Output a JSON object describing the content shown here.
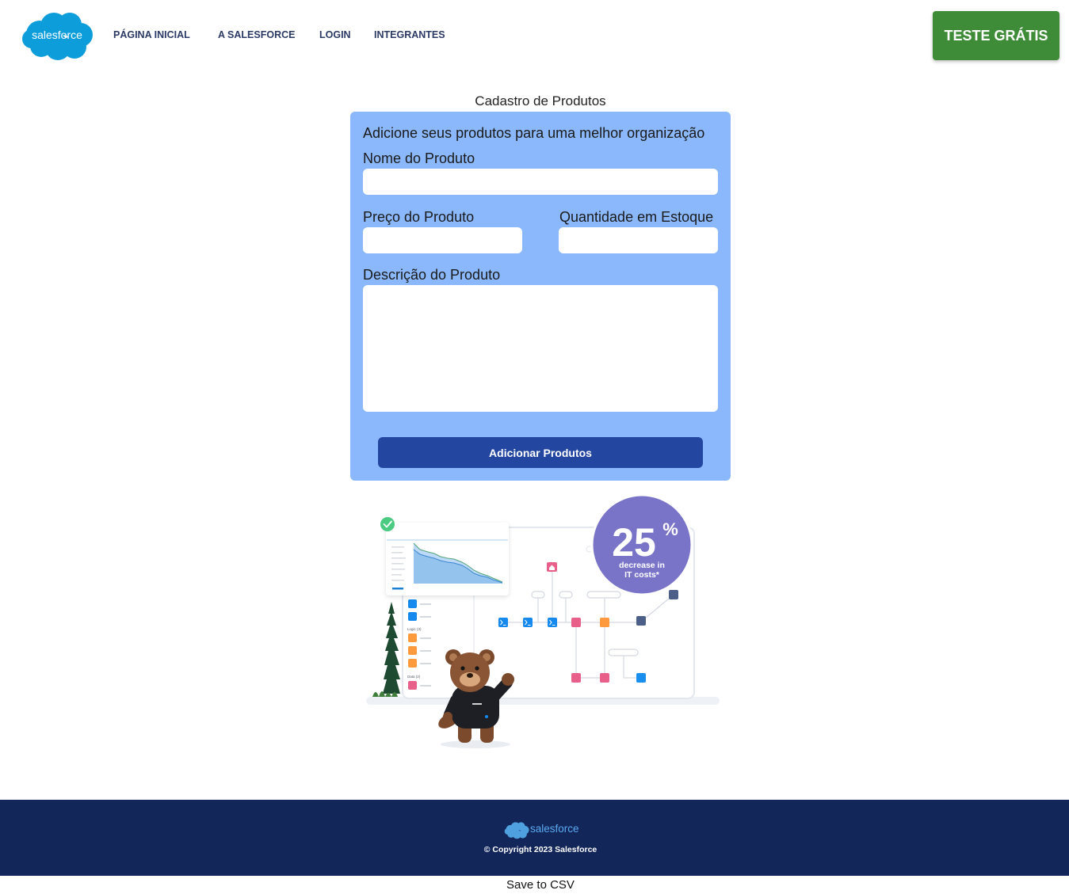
{
  "colors": {
    "brand_blue": "#0d9dda",
    "cta_green": "#3f8c38",
    "card_bg": "#8bb8fc",
    "submit_bg": "#2346a0",
    "footer_bg": "#13265a",
    "nav_text": "#2c3a66",
    "stat_purple": "#7a74c8"
  },
  "header": {
    "logo_icon": "salesforce-cloud-logo",
    "logo_text": "salesforce",
    "nav": [
      {
        "label": "PÁGINA INICIAL"
      },
      {
        "label": "A SALESFORCE"
      },
      {
        "label": "LOGIN"
      },
      {
        "label": "INTEGRANTES"
      }
    ],
    "cta_label": "TESTE GRÁTIS"
  },
  "form": {
    "title": "Cadastro de Produtos",
    "subtitle": "Adicione seus produtos para uma melhor organização",
    "name_label": "Nome do Produto",
    "price_label": "Preço do Produto",
    "quantity_label": "Quantidade em Estoque",
    "description_label": "Descrição do Produto",
    "submit_label": "Adicionar Produtos"
  },
  "illustration": {
    "stat_value": "25",
    "stat_unit": "%",
    "stat_caption_line1": "decrease in",
    "stat_caption_line2": "IT costs*",
    "sidebar_groups": [
      "Logic (3)",
      "Data (2)"
    ],
    "icons": [
      "check-circle-icon",
      "flow-node-icon",
      "home-icon",
      "mascot"
    ]
  },
  "footer": {
    "logo_text": "salesforce",
    "copyright": "© Copyright 2023 Salesforce"
  },
  "save_csv_label": "Save to CSV"
}
